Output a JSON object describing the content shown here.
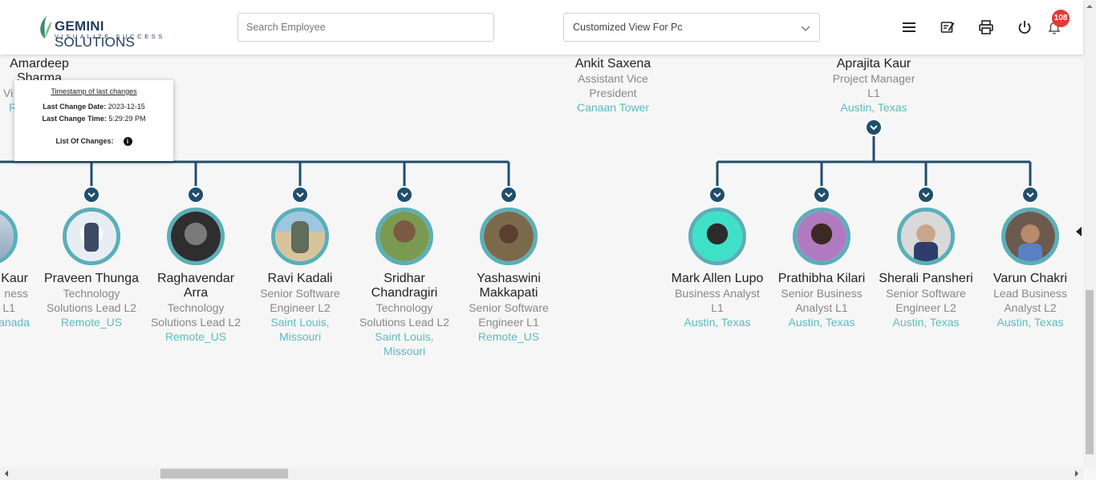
{
  "header": {
    "logo_name": "GEMINI",
    "logo_name_suffix": "SOLUTIONS",
    "logo_tagline": "VISUALIZE SUCCESS",
    "search_placeholder": "Search Employee",
    "view_selected": "Customized View For Pc",
    "notification_count": "108",
    "icons": [
      "menu-icon",
      "edit-note-icon",
      "print-icon",
      "power-icon",
      "bell-icon"
    ]
  },
  "tooltip": {
    "title": "Timestamp of last changes",
    "date_label": "Last Change Date:",
    "date_value": "2023-12-15",
    "time_label": "Last Change Time:",
    "time_value": "5:29:29 PM",
    "changes_label": "List Of Changes:"
  },
  "top_people": [
    {
      "name_line1": "Amardeep",
      "name_line2": "Sharma",
      "role": "Vi",
      "loc": "R"
    },
    {
      "name": "Ankit Saxena",
      "role_line1": "Assistant Vice",
      "role_line2": "President",
      "location": "Canaan Tower"
    },
    {
      "name": "Aprajita Kaur",
      "role_line1": "Project Manager",
      "role_line2": "L1",
      "location": "Austin, Texas"
    }
  ],
  "left_group": [
    {
      "name": "Kaur",
      "role1": "ness",
      "role2": "L1",
      "loc1": "anada"
    },
    {
      "name": "Praveen Thunga",
      "role1": "Technology",
      "role2": "Solutions Lead L2",
      "loc1": "Remote_US"
    },
    {
      "name1": "Raghavendar",
      "name2": "Arra",
      "role1": "Technology",
      "role2": "Solutions Lead L2",
      "loc1": "Remote_US"
    },
    {
      "name": "Ravi Kadali",
      "role1": "Senior Software",
      "role2": "Engineer L2",
      "loc1": "Saint Louis,",
      "loc2": "Missouri"
    },
    {
      "name1": "Sridhar",
      "name2": "Chandragiri",
      "role1": "Technology",
      "role2": "Solutions Lead L2",
      "loc1": "Saint Louis,",
      "loc2": "Missouri"
    },
    {
      "name1": "Yashaswini",
      "name2": "Makkapati",
      "role1": "Senior Software",
      "role2": "Engineer L1",
      "loc1": "Remote_US"
    }
  ],
  "right_group": [
    {
      "name": "Mark Allen Lupo",
      "role1": "Business Analyst",
      "role2": "L1",
      "loc1": "Austin, Texas"
    },
    {
      "name": "Prathibha Kilari",
      "role1": "Senior Business",
      "role2": "Analyst L1",
      "loc1": "Austin, Texas"
    },
    {
      "name": "Sherali Pansheri",
      "role1": "Senior Software",
      "role2": "Engineer L2",
      "loc1": "Austin, Texas"
    },
    {
      "name": "Varun Chakri",
      "role1": "Lead Business",
      "role2": "Analyst L2",
      "loc1": "Austin, Texas"
    }
  ],
  "colors": {
    "connector": "#1f4e6d",
    "avatar_ring": "#5aafb8",
    "location_text": "#5bbcc2",
    "badge": "#e53935"
  }
}
